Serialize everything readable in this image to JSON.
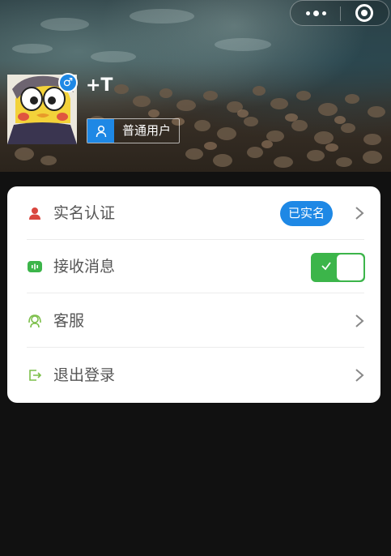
{
  "profile": {
    "username": "+T",
    "gender_symbol": "♂",
    "role_label": "普通用户"
  },
  "menu": {
    "items": [
      {
        "label": "实名认证",
        "badge": "已实名",
        "icon": "person-icon"
      },
      {
        "label": "接收消息",
        "toggle_on": true,
        "icon": "message-icon"
      },
      {
        "label": "客服",
        "icon": "headset-icon"
      },
      {
        "label": "退出登录",
        "icon": "logout-icon"
      }
    ]
  },
  "colors": {
    "accent_blue": "#1e88e5",
    "toggle_green": "#3cb54a",
    "person_icon_red": "#d9463e",
    "card_bg": "#ffffff",
    "page_bg": "#111111"
  }
}
